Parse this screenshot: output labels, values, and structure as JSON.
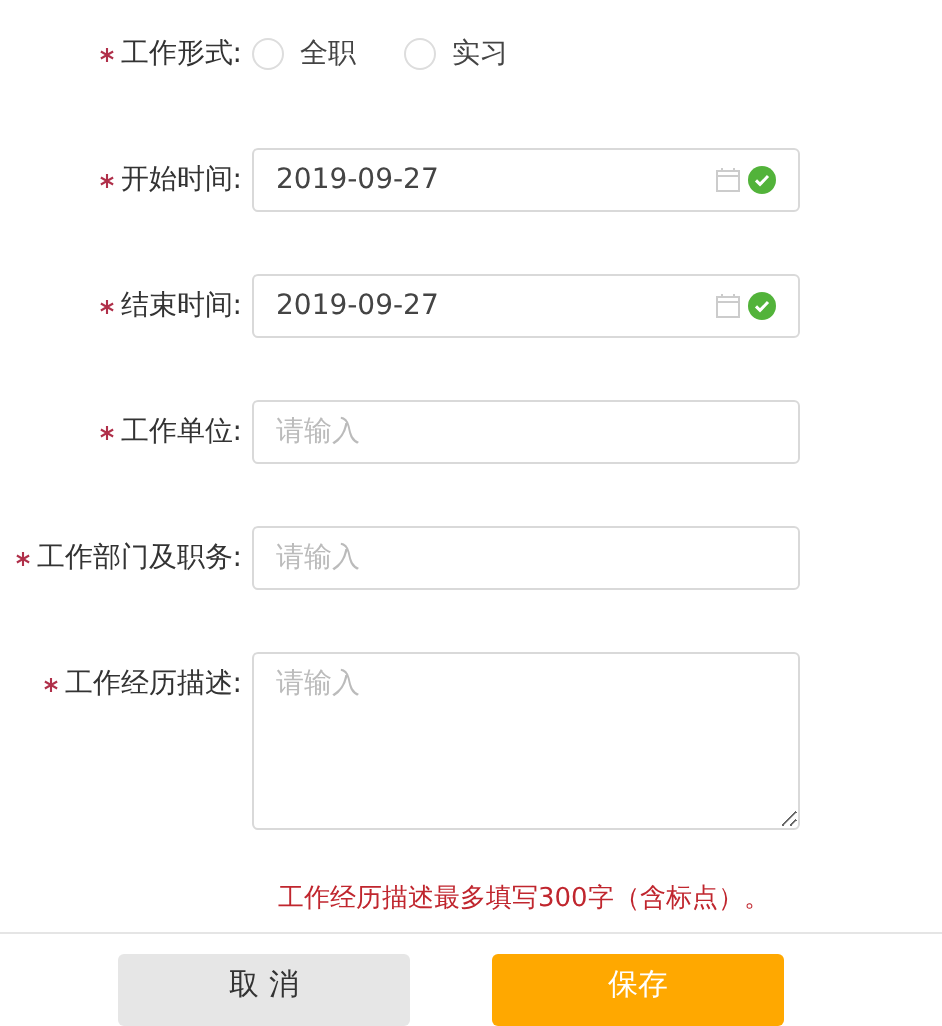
{
  "fields": [
    {
      "kind": "radio",
      "label": "工作形式:",
      "required": true,
      "options": [
        {
          "label": "全职",
          "selected": false
        },
        {
          "label": "实习",
          "selected": false
        }
      ]
    },
    {
      "kind": "date",
      "label": "开始时间:",
      "required": true,
      "value": "2019-09-27",
      "valid": true
    },
    {
      "kind": "date",
      "label": "结束时间:",
      "required": true,
      "value": "2019-09-27",
      "valid": true
    },
    {
      "kind": "text",
      "label": "工作单位:",
      "required": true,
      "placeholder": "请输入"
    },
    {
      "kind": "text",
      "label": "工作部门及职务:",
      "required": true,
      "placeholder": "请输入"
    },
    {
      "kind": "textarea",
      "label": "工作经历描述:",
      "required": true,
      "placeholder": "请输入"
    }
  ],
  "note": "工作经历描述最多填写300字（含标点）。",
  "buttons": [
    {
      "label": "取 消",
      "kind": "secondary"
    },
    {
      "label": "保存",
      "kind": "primary"
    }
  ]
}
